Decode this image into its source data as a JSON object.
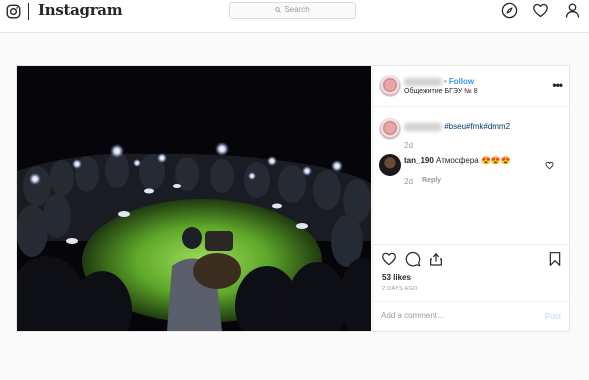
{
  "nav": {
    "logo_text": "Instagram",
    "search_placeholder": "Search",
    "icons": [
      "camera-icon",
      "compass-icon",
      "heart-icon",
      "profile-icon"
    ]
  },
  "post": {
    "username_blurred": "",
    "follow_label": "Follow",
    "location": "Общежитие БГЭУ № 8",
    "more_label": "•••",
    "caption": {
      "hashtags": "#bseu#fmk#dmm2",
      "time": "2d"
    },
    "comment": {
      "username": "tan_190",
      "text": "Атмосфера 😍😍😍",
      "time": "2d",
      "reply_label": "Reply"
    },
    "likes": "53 likes",
    "time_ago": "2 DAYS AGO",
    "add_comment_placeholder": "Add a comment…",
    "post_label": "Post"
  },
  "colors": {
    "link_blue": "#3897f0",
    "hashtag": "#003569",
    "post_disabled": "#b2dffc"
  }
}
